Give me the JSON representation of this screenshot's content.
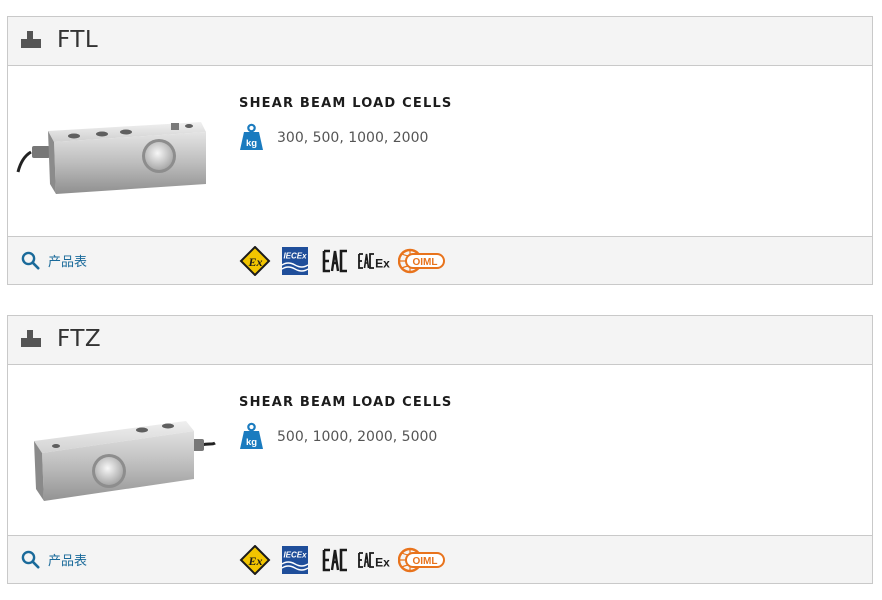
{
  "products": [
    {
      "name": "FTL",
      "category": "SHEAR BEAM LOAD CELLS",
      "capacities": "300, 500, 1000, 2000",
      "datasheet_label": "产品表",
      "certifications": [
        "ATEX Ex",
        "IECEx",
        "EAC",
        "EAC Ex",
        "OIML"
      ]
    },
    {
      "name": "FTZ",
      "category": "SHEAR BEAM LOAD CELLS",
      "capacities": "500, 1000, 2000, 5000",
      "datasheet_label": "产品表",
      "certifications": [
        "ATEX Ex",
        "IECEx",
        "EAC",
        "EAC Ex",
        "OIML"
      ]
    }
  ],
  "icons": {
    "header": "load-cell-icon",
    "capacity": "kg-weight-icon",
    "datasheet": "search-icon"
  },
  "colors": {
    "header_bg": "#f4f4f4",
    "border": "#c9c9c9",
    "kg_badge": "#1a7bbf",
    "link": "#1a6a9a",
    "atex_yellow": "#f2c500",
    "iecex_blue": "#1f4e9a",
    "oiml_orange": "#e8731c"
  }
}
